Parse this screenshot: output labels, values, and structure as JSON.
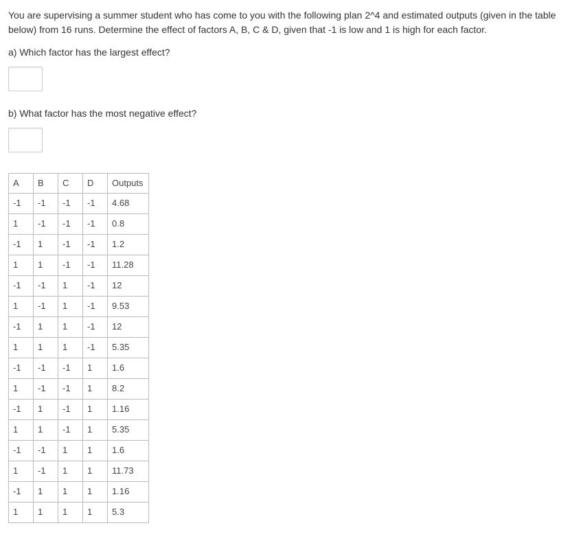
{
  "intro": "You are supervising a summer student who has come to you with the following plan 2^4 and estimated outputs (given in the table below) from 16 runs. Determine the effect of factors A, B, C & D, given that -1 is low and 1 is high for each factor.",
  "question_a": "a) Which factor has the largest effect?",
  "question_b": "b) What factor has the most negative effect?",
  "table": {
    "headers": [
      "A",
      "B",
      "C",
      "D",
      "Outputs"
    ],
    "rows": [
      [
        "-1",
        "-1",
        "-1",
        "-1",
        "4.68"
      ],
      [
        "1",
        "-1",
        "-1",
        "-1",
        "0.8"
      ],
      [
        "-1",
        "1",
        "-1",
        "-1",
        "1.2"
      ],
      [
        "1",
        "1",
        "-1",
        "-1",
        "11.28"
      ],
      [
        "-1",
        "-1",
        "1",
        "-1",
        "12"
      ],
      [
        "1",
        "-1",
        "1",
        "-1",
        "9.53"
      ],
      [
        "-1",
        "1",
        "1",
        "-1",
        "12"
      ],
      [
        "1",
        "1",
        "1",
        "-1",
        "5.35"
      ],
      [
        "-1",
        "-1",
        "-1",
        "1",
        "1.6"
      ],
      [
        "1",
        "-1",
        "-1",
        "1",
        "8.2"
      ],
      [
        "-1",
        "1",
        "-1",
        "1",
        "1.16"
      ],
      [
        "1",
        "1",
        "-1",
        "1",
        "5.35"
      ],
      [
        "-1",
        "-1",
        "1",
        "1",
        "1.6"
      ],
      [
        "1",
        "-1",
        "1",
        "1",
        "11.73"
      ],
      [
        "-1",
        "1",
        "1",
        "1",
        "1.16"
      ],
      [
        "1",
        "1",
        "1",
        "1",
        "5.3"
      ]
    ]
  }
}
